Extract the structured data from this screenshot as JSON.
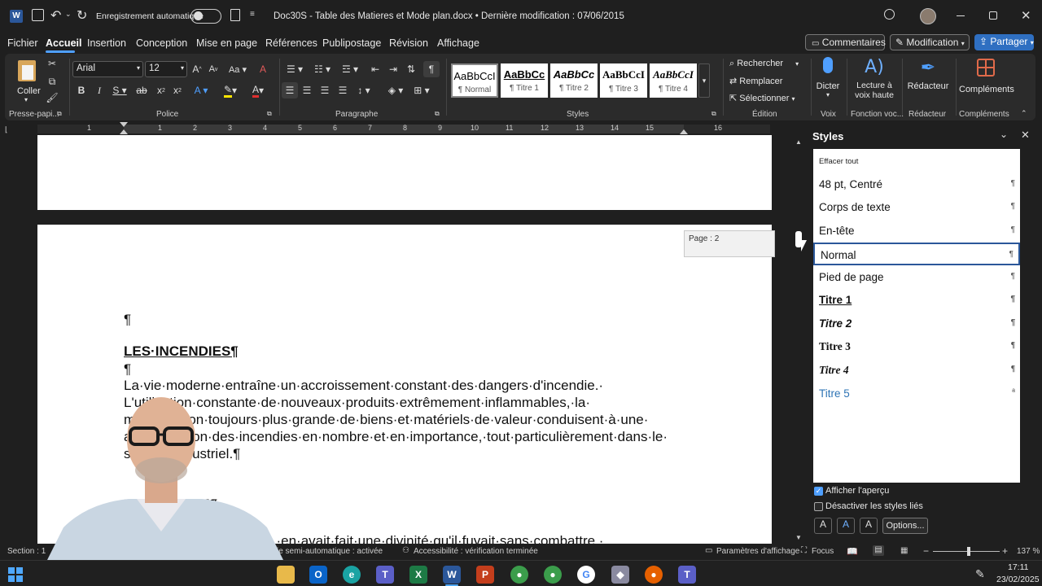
{
  "titlebar": {
    "autosave_label": "Enregistrement automatique",
    "doc_title": "Doc30S - Table des Matieres et Mode plan.docx • Dernière modification : 07/06/2015"
  },
  "menu": {
    "items": [
      "Fichier",
      "Accueil",
      "Insertion",
      "Conception",
      "Mise en page",
      "Références",
      "Publipostage",
      "Révision",
      "Affichage"
    ],
    "comments": "Commentaires",
    "editing": "Modification",
    "share": "Partager"
  },
  "ribbon": {
    "paste_label": "Coller",
    "font_name": "Arial",
    "font_size": "12",
    "groups": {
      "clipboard": "Presse-papi...",
      "font": "Police",
      "paragraph": "Paragraphe",
      "styles": "Styles",
      "editing": "Édition",
      "voice": "Voix",
      "voice_fn": "Fonction voc...",
      "editor": "Rédacteur",
      "addins": "Compléments"
    },
    "style_tiles": [
      {
        "preview": "AaBbCcI",
        "name": "¶ Normal"
      },
      {
        "preview": "AaBbCc",
        "name": "¶ Titre 1"
      },
      {
        "preview": "AaBbCc",
        "name": "¶ Titre 2"
      },
      {
        "preview": "AaBbCcI",
        "name": "¶ Titre 3"
      },
      {
        "preview": "AaBbCcI",
        "name": "¶ Titre 4"
      }
    ],
    "find": "Rechercher",
    "replace": "Remplacer",
    "select": "Sélectionner",
    "dictate": "Dicter",
    "read_aloud_1": "Lecture à",
    "read_aloud_2": "voix haute",
    "editor": "Rédacteur",
    "addins": "Compléments"
  },
  "ruler": {
    "numbers": [
      "1",
      "1",
      "2",
      "3",
      "4",
      "5",
      "6",
      "7",
      "8",
      "9",
      "10",
      "11",
      "12",
      "13",
      "14",
      "15",
      "16"
    ]
  },
  "document": {
    "page_tooltip": "Page : 2",
    "pilcrow": "¶",
    "heading": "LES·INCENDIES¶",
    "pilcrow2": "¶",
    "line1": "La·vie·moderne·entraîne·un·accroissement·constant·des·dangers·d'incendie.·",
    "line2": "L'utilisation·constante·de·nouveaux·produits·extrêmement·inflammables,·la·",
    "line3": "multiplication·toujours·plus·grande·de·biens·et·matériels·de·valeur·conduisent·à·une·",
    "line4": "augmentation·des·incendies·en·nombre·et·en·importance,·tout·particulièrement·dans·le·",
    "line5": "secteur·industriel.¶",
    "line6": "HISTORIQUE¶",
    "line7": "L'homme·qui·puis·le·feu,·en·avait·fait·une·divinité·qu'il·fuyait·sans·combattre.·"
  },
  "styles_pane": {
    "title": "Styles",
    "clear_all": "Effacer tout",
    "items": [
      {
        "name": "48 pt, Centré",
        "mark": "¶"
      },
      {
        "name": "Corps de texte",
        "mark": "¶"
      },
      {
        "name": "En-tête",
        "mark": "¶"
      },
      {
        "name": "Normal",
        "mark": "¶"
      },
      {
        "name": "Pied de page",
        "mark": "¶"
      },
      {
        "name": "Titre 1",
        "mark": "¶"
      },
      {
        "name": "Titre 2",
        "mark": "¶"
      },
      {
        "name": "Titre 3",
        "mark": "¶"
      },
      {
        "name": "Titre 4",
        "mark": "¶"
      },
      {
        "name": "Titre 5",
        "mark": "ª"
      }
    ],
    "show_preview": "Afficher l'aperçu",
    "disable_linked": "Désactiver les styles liés",
    "options": "Options..."
  },
  "statusbar": {
    "section": "Section : 1",
    "autosave_mode": "ie semi-automatique : activée",
    "accessibility": "Accessibilité : vérification terminée",
    "display_settings": "Paramètres d'affichage",
    "focus": "Focus",
    "zoom": "137 %"
  },
  "taskbar": {
    "time": "17:11",
    "date": "23/02/2025"
  },
  "colors": {
    "accent": "#4f9fff",
    "word_blue": "#2b579a",
    "titre5": "#2e74b5"
  }
}
